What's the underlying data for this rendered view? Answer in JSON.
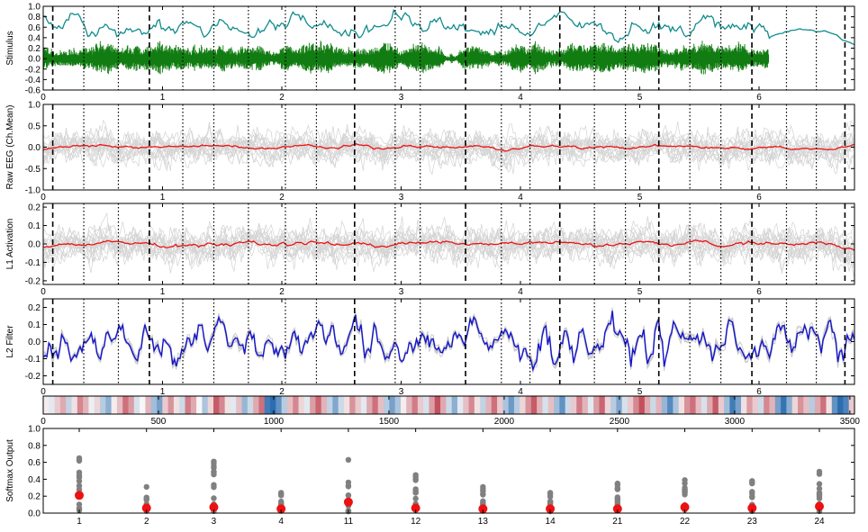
{
  "chart_data": [
    {
      "type": "line",
      "ylabel": "Stimulus",
      "ylim": [
        -0.6,
        1.0
      ],
      "yticks": [
        "1.0",
        "0.8",
        "0.6",
        "0.4",
        "0.2",
        "0.0",
        "-0.2",
        "-0.4",
        "-0.6"
      ],
      "xlim": [
        0,
        6.8
      ],
      "xticks": [
        "0",
        "1",
        "2",
        "3",
        "4",
        "5",
        "6"
      ],
      "series": [
        {
          "style": "envelope",
          "color": "#118c8c"
        },
        {
          "style": "waveform",
          "color": "#117c11"
        }
      ]
    },
    {
      "type": "line",
      "ylabel": "Raw EEG (Ch.Mean)",
      "ylim": [
        -1.0,
        1.0
      ],
      "yticks": [
        "1.0",
        "0.5",
        "0.0",
        "-0.5",
        "-1.0"
      ],
      "xlim": [
        0,
        6.8
      ],
      "xticks": [
        "0",
        "1",
        "2",
        "3",
        "4",
        "5",
        "6"
      ],
      "series": [
        {
          "style": "individual channels",
          "color": "#d3d3d3"
        },
        {
          "style": "mean",
          "color": "#ee1111"
        }
      ]
    },
    {
      "type": "line",
      "ylabel": "L1 Activation",
      "ylim": [
        -0.22,
        0.22
      ],
      "yticks": [
        "0.2",
        "0.1",
        "0.0",
        "-0.1",
        "-0.2"
      ],
      "xlim": [
        0,
        6.8
      ],
      "xticks": [
        "0",
        "1",
        "2",
        "3",
        "4",
        "5",
        "6"
      ],
      "series": [
        {
          "style": "individual units",
          "color": "#d3d3d3"
        },
        {
          "style": "mean",
          "color": "#ee1111"
        }
      ]
    },
    {
      "type": "line",
      "ylabel": "L2 Filter",
      "ylim": [
        -0.25,
        0.25
      ],
      "yticks": [
        "0.2",
        "0.1",
        "0.0",
        "-0.1",
        "-0.2"
      ],
      "xlim": [
        0,
        6.8
      ],
      "xticks": [
        "0",
        "1",
        "2",
        "3",
        "4",
        "5",
        "6"
      ],
      "series": [
        {
          "style": "individual units",
          "color": "#c8c8c8"
        },
        {
          "style": "mean",
          "color": "#1515cc"
        }
      ]
    },
    {
      "type": "heatmap",
      "xlim": [
        0,
        3520
      ],
      "xticks": [
        "0",
        "500",
        "1000",
        "1500",
        "2000",
        "2500",
        "3000",
        "3500"
      ],
      "colormap": [
        "#2166ac",
        "#f7f7f7",
        "#b2182b"
      ]
    },
    {
      "type": "scatter",
      "ylabel": "Softmax Output",
      "ylim": [
        0.0,
        1.0
      ],
      "yticks": [
        "1.0",
        "0.8",
        "0.6",
        "0.4",
        "0.2",
        "0.0"
      ],
      "categories": [
        "1",
        "2",
        "3",
        "4",
        "11",
        "12",
        "13",
        "14",
        "21",
        "22",
        "23",
        "24"
      ],
      "means": [
        0.21,
        0.06,
        0.07,
        0.05,
        0.13,
        0.06,
        0.05,
        0.05,
        0.05,
        0.07,
        0.06,
        0.08
      ],
      "max_values": [
        0.65,
        0.31,
        0.61,
        0.24,
        0.63,
        0.45,
        0.31,
        0.24,
        0.35,
        0.39,
        0.38,
        0.49
      ],
      "series": [
        {
          "style": "individual trials",
          "color": "#808080"
        },
        {
          "style": "mean",
          "color": "#ee1111"
        }
      ]
    }
  ],
  "markers": {
    "dashed": [
      0.08,
      0.89,
      2.61,
      3.54,
      4.33,
      5.16,
      5.94,
      6.72
    ],
    "dotted": [
      0.34,
      0.63,
      1.17,
      1.43,
      1.72,
      2.03,
      2.29,
      2.95,
      3.16,
      3.84,
      4.08,
      4.62,
      4.88,
      5.42,
      5.68,
      6.23,
      6.48
    ]
  },
  "heatmap_cells": [
    0.05,
    -0.1,
    0.2,
    0.35,
    -0.25,
    0.1,
    0.5,
    0.3,
    -0.05,
    0.15,
    -0.3,
    -0.5,
    0.05,
    0.25,
    0.6,
    0.4,
    -0.15,
    0.0,
    0.3,
    -0.4,
    -0.6,
    0.2,
    0.45,
    0.1,
    -0.2,
    0.55,
    0.35,
    0.0,
    -0.35,
    0.15,
    0.7,
    0.5,
    0.1,
    -0.1,
    0.25,
    -0.45,
    -0.2,
    0.35,
    0.6,
    -0.85,
    -0.95,
    -0.7,
    -0.3,
    0.25,
    0.5,
    0.15,
    -0.1,
    0.4,
    0.65,
    0.3,
    -0.25,
    -0.55,
    -0.2,
    0.1,
    0.45,
    0.2,
    -0.1,
    0.35,
    0.6,
    0.25,
    -0.3,
    -0.6,
    -0.35,
    0.05,
    0.3,
    0.55,
    0.2,
    -0.15,
    0.4,
    0.75,
    0.35,
    -0.2,
    -0.5,
    -0.1,
    0.25,
    0.5,
    0.1,
    -0.25,
    0.3,
    0.6,
    0.2,
    -0.35,
    -0.65,
    -0.3,
    0.15,
    0.45,
    0.7,
    0.3,
    -0.15,
    0.25,
    -0.4,
    -0.7,
    -0.2,
    0.2,
    0.55,
    0.3,
    -0.1,
    0.4,
    0.65,
    0.15,
    -0.3,
    -0.55,
    -0.15,
    0.2,
    0.5,
    0.75,
    0.35,
    -0.2,
    0.3,
    -0.45,
    -0.75,
    -0.35,
    0.1,
    0.45,
    0.6,
    0.25,
    -0.15,
    0.35,
    0.7,
    0.2,
    -0.4,
    -0.85,
    -0.6,
    0.1,
    0.4,
    0.2,
    -0.2,
    0.5,
    0.3,
    -0.6,
    -0.9,
    -0.5,
    0.15,
    0.45,
    0.25,
    -0.3,
    0.35,
    0.6,
    0.1,
    -0.7,
    -0.95,
    -0.8,
    0.2
  ]
}
